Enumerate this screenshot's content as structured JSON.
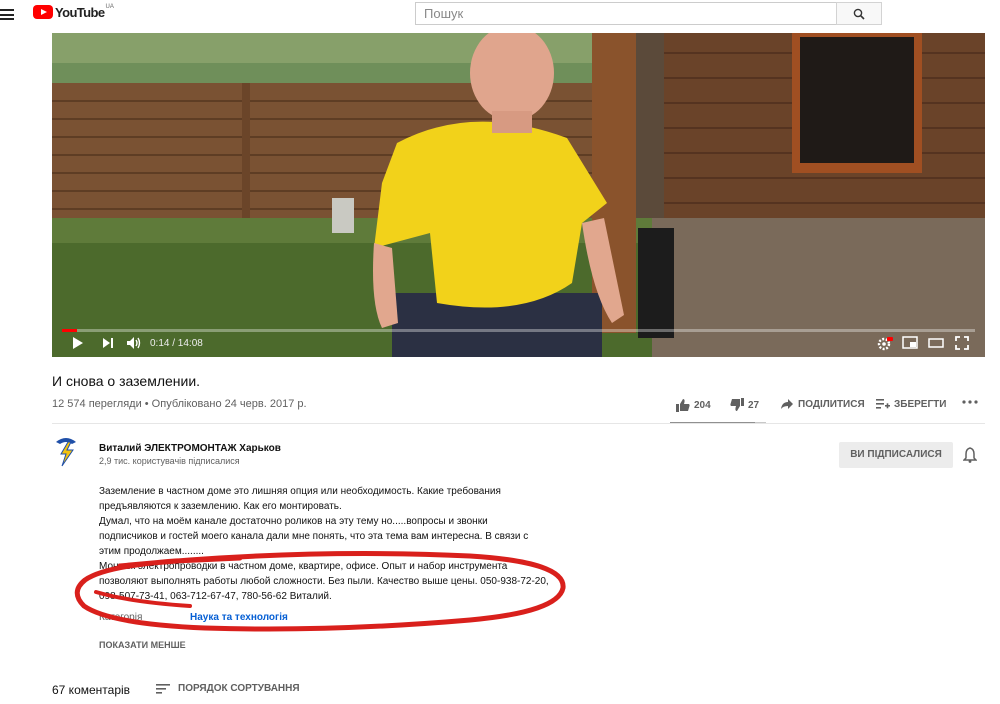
{
  "header": {
    "logo_text": "YouTube",
    "logo_country": "UA",
    "search_placeholder": "Пошук"
  },
  "player": {
    "time_current": "0:14",
    "time_total": "14:08",
    "time_display": "0:14 / 14:08",
    "progress": 0.0165
  },
  "video": {
    "title": "И снова о заземлении.",
    "views": "12 574 перегляди",
    "published": "Опубліковано 24 черв. 2017 р.",
    "meta_line": "12 574 перегляди • Опубліковано 24 черв. 2017 р.",
    "likes": "204",
    "dislikes": "27",
    "like_ratio": 0.883,
    "share_label": "ПОДІЛИТИСЯ",
    "save_label": "ЗБЕРЕГТИ"
  },
  "channel": {
    "name": "Виталий ЭЛЕКТРОМОНТАЖ Харьков",
    "subscribers": "2,9 тис. користувачів підписалися",
    "subscribe_label": "ВИ ПІДПИСАЛИСЯ"
  },
  "description": {
    "lines": [
      "Заземление в частном доме это лишняя опция или необходимость. Какие требования предъявляются к заземлению. Как его монтировать.",
      "Думал, что на моём канале достаточно роликов на эту тему но.....вопросы и звонки подписчиков и гостей моего канала дали мне понять, что эта тема вам интересна. В связи с этим продолжаем........",
      " Монтаж электропроводки в частном доме, квартире, офисе. Опыт и набор инструмента позволяют выполнять работы любой сложности. Без пыли. Качество выше цены. 050-938-72-20, 098-507-73-41, 063-712-67-47, 780-56-62 Виталий."
    ],
    "category_label": "Категорія",
    "category_value": "Наука та технологія",
    "show_less": "ПОКАЗАТИ МЕНШЕ"
  },
  "comments": {
    "count_label": "67 коментарів",
    "sort_label": "ПОРЯДОК СОРТУВАННЯ"
  },
  "colors": {
    "brand_red": "#ff0000",
    "link_blue": "#065fd4",
    "annotation_red": "#d9201c"
  }
}
